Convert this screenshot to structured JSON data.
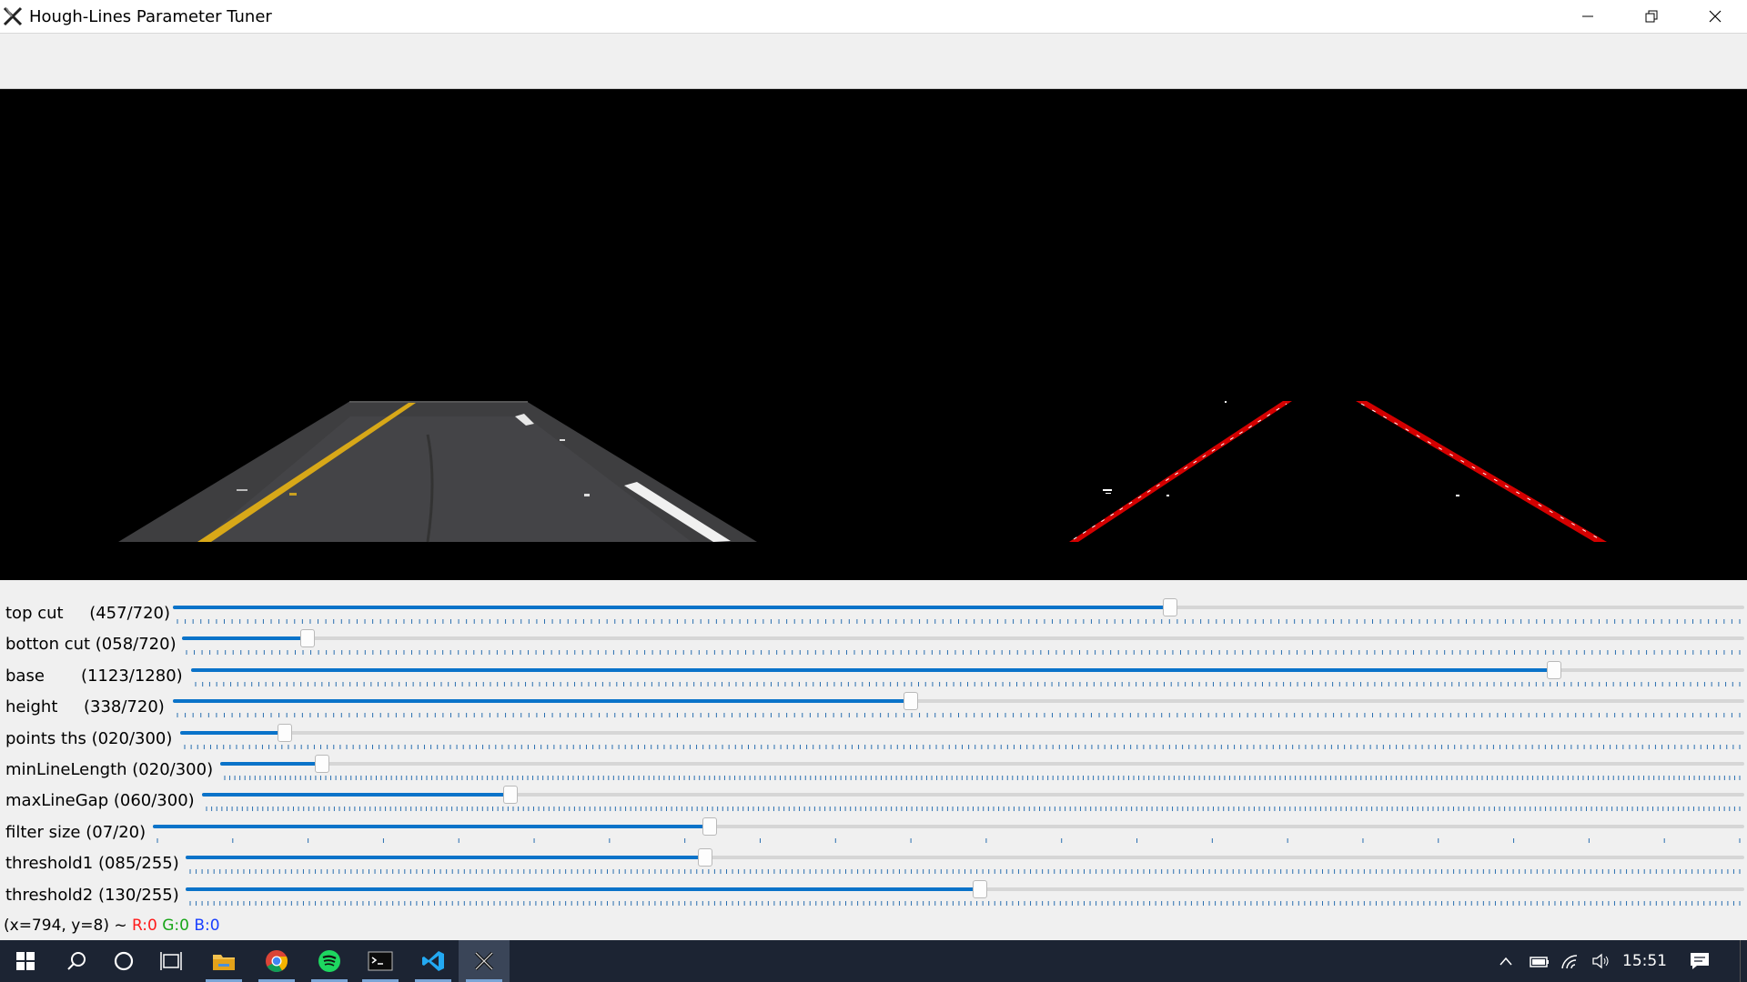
{
  "window": {
    "title": "Hough-Lines Parameter Tuner",
    "minimize_icon": "minimize-icon",
    "maximize_icon": "restore-icon",
    "close_icon": "close-icon"
  },
  "sliders": [
    {
      "label": "top cut     (457/720)",
      "value": 457,
      "max": 720
    },
    {
      "label": "botton cut (058/720)",
      "value": 58,
      "max": 720
    },
    {
      "label": "base       (1123/1280)",
      "value": 1123,
      "max": 1280
    },
    {
      "label": "height     (338/720)",
      "value": 338,
      "max": 720
    },
    {
      "label": "points ths (020/300)",
      "value": 20,
      "max": 300
    },
    {
      "label": "minLineLength (020/300)",
      "value": 20,
      "max": 300
    },
    {
      "label": "maxLineGap (060/300)",
      "value": 60,
      "max": 300
    },
    {
      "label": "filter size (07/20)",
      "value": 7,
      "max": 20
    },
    {
      "label": "threshold1 (085/255)",
      "value": 85,
      "max": 255
    },
    {
      "label": "threshold2 (130/255)",
      "value": 130,
      "max": 255
    }
  ],
  "status": {
    "coords": "(x=794, y=8) ~",
    "r": "R:0",
    "g": "G:0",
    "b": "B:0"
  },
  "taskbar": {
    "items": [
      "windows-start-icon",
      "search-icon",
      "cortana-icon",
      "task-view-icon",
      "file-explorer-icon",
      "chrome-icon",
      "spotify-icon",
      "terminal-icon",
      "vscode-icon",
      "xming-icon"
    ],
    "clock": "15:51"
  },
  "colors": {
    "accent": "#0a73c9",
    "lane_line": "#d40000",
    "yellow_line": "#e0b020"
  }
}
